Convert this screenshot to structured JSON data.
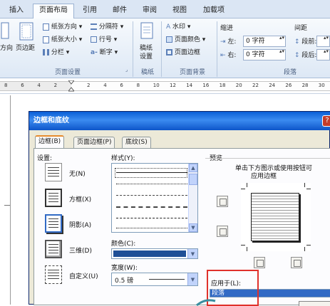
{
  "ribbon": {
    "tabs": [
      "插入",
      "页面布局",
      "引用",
      "邮件",
      "审阅",
      "视图",
      "加载项"
    ],
    "active_tab": 1,
    "page_setup": {
      "orientation_cut": "方向",
      "margins": "页边距",
      "paper_orientation": "纸张方向",
      "paper_size": "纸张大小",
      "columns": "分栏",
      "breaks": "分隔符",
      "line_numbers": "行号",
      "hyphenation": "断字",
      "group_label": "页面设置"
    },
    "draft_paper": {
      "label_line1": "稿纸",
      "label_line2": "设置",
      "group_label": "稿纸"
    },
    "page_background": {
      "watermark": "水印",
      "page_color": "页面颜色",
      "page_borders": "页面边框",
      "group_label": "页面背景"
    },
    "paragraph": {
      "indent_title": "缩进",
      "spacing_title": "间距",
      "left_label": "左:",
      "left_value": "0 字符",
      "right_label": "右:",
      "right_value": "0 字符",
      "before_label": "段前:",
      "after_label": "段后:",
      "group_label": "段落"
    }
  },
  "ruler": {
    "numbers": [
      "8",
      "6",
      "4",
      "2",
      "",
      "2",
      "4",
      "6",
      "8",
      "10",
      "12",
      "14",
      "16",
      "18",
      "20",
      "22",
      "24",
      "26",
      "28",
      "30"
    ]
  },
  "dialog": {
    "title": "边框和底纹",
    "tabs": [
      "边框(B)",
      "页面边框(P)",
      "底纹(S)"
    ],
    "selected_tab": 0,
    "setting_label": "设置:",
    "settings": [
      "无(N)",
      "方框(X)",
      "阴影(A)",
      "三维(D)",
      "自定义(U)"
    ],
    "selected_setting": 2,
    "style_label": "样式(Y):",
    "color_label": "颜色(C):",
    "width_label": "宽度(W):",
    "width_value": "0.5 磅",
    "preview_label": "预览",
    "preview_hint_line1": "单击下方图示或使用按钮可",
    "preview_hint_line2": "应用边框",
    "apply_to_label": "应用于(L):",
    "apply_to_value": "段落",
    "colors": {
      "highlight": "#316ac5",
      "red_box": "#e0312b",
      "color_swatch": "#1f4f96"
    }
  }
}
